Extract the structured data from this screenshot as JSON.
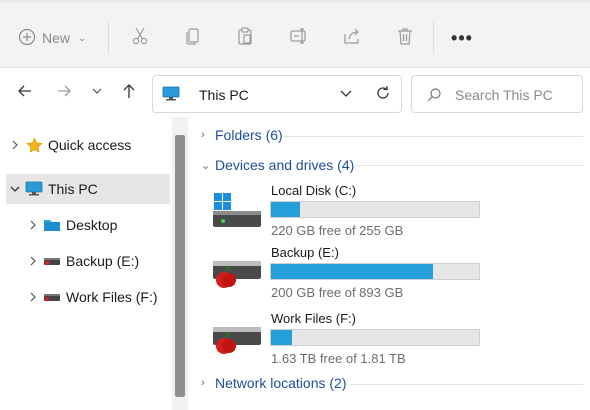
{
  "toolbar": {
    "new_label": "New",
    "icons": [
      "plus-circle-icon",
      "cut-icon",
      "copy-icon",
      "paste-icon",
      "rename-icon",
      "share-icon",
      "delete-icon",
      "more-icon"
    ],
    "more_label": "•••"
  },
  "nav": {
    "address_text": "This PC",
    "search_placeholder": "Search This PC"
  },
  "sidebar": {
    "items": [
      {
        "label": "Quick access",
        "icon": "star-icon"
      },
      {
        "label": "This PC",
        "icon": "pc-icon",
        "selected": true
      },
      {
        "label": "Desktop",
        "icon": "desktop-folder-icon"
      },
      {
        "label": "Backup (E:)",
        "icon": "drive-icon"
      },
      {
        "label": "Work Files (F:)",
        "icon": "drive-icon"
      }
    ]
  },
  "main": {
    "groups": {
      "folders": "Folders (6)",
      "devices": "Devices and drives (4)",
      "network": "Network locations (2)"
    },
    "drives": [
      {
        "name": "Local Disk (C:)",
        "free_text": "220 GB free of 255 GB",
        "used_fraction": 0.14,
        "icon": "windows-drive-icon"
      },
      {
        "name": "Backup (E:)",
        "free_text": "200 GB free of 893 GB",
        "used_fraction": 0.78,
        "icon": "apple-drive-icon"
      },
      {
        "name": "Work Files (F:)",
        "free_text": "1.63 TB free of 1.81 TB",
        "used_fraction": 0.1,
        "icon": "apple-drive-icon"
      }
    ]
  },
  "colors": {
    "accent": "#26a0da",
    "link": "#1f4e9c",
    "selected_bg": "#e6e6e6"
  }
}
